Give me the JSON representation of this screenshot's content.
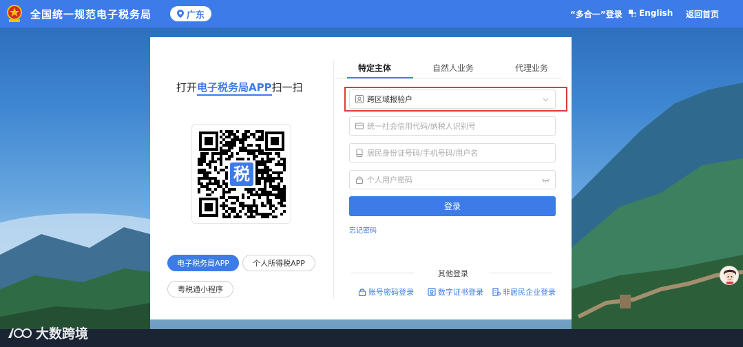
{
  "header": {
    "site_title": "全国统一规范电子税务局",
    "region": "广东",
    "links": {
      "multi_login": "“多合一”登录",
      "english": "English",
      "home": "返回首页"
    }
  },
  "qr_panel": {
    "title_prefix": "打开",
    "title_highlight": "电子税务局APP",
    "title_suffix": "扫一扫",
    "qr_center_char": "税",
    "apps": [
      {
        "label": "电子税务局APP",
        "active": true
      },
      {
        "label": "个人所得税APP",
        "active": false
      },
      {
        "label": "粤税通小程序",
        "active": false
      }
    ]
  },
  "tabs": [
    {
      "label": "特定主体",
      "active": true
    },
    {
      "label": "自然人业务",
      "active": false
    },
    {
      "label": "代理业务",
      "active": false
    }
  ],
  "form": {
    "identity_select": "跨区域报验户",
    "credit_code_placeholder": "统一社会信用代码/纳税人识别号",
    "id_placeholder": "居民身份证号码/手机号码/用户名",
    "password_placeholder": "个人用户密码",
    "login_label": "登录",
    "forgot_label": "忘记密码"
  },
  "other_login": {
    "title": "其他登录",
    "options": [
      {
        "label": "账号密码登录",
        "icon": "lock-icon"
      },
      {
        "label": "数字证书登录",
        "icon": "certificate-icon"
      },
      {
        "label": "非居民企业登录",
        "icon": "enterprise-icon"
      }
    ]
  },
  "watermark": {
    "text": "大数跨境"
  },
  "colors": {
    "primary": "#3d7be8",
    "highlight_border": "#e23a3a",
    "header_bg": "#3d7be8"
  }
}
